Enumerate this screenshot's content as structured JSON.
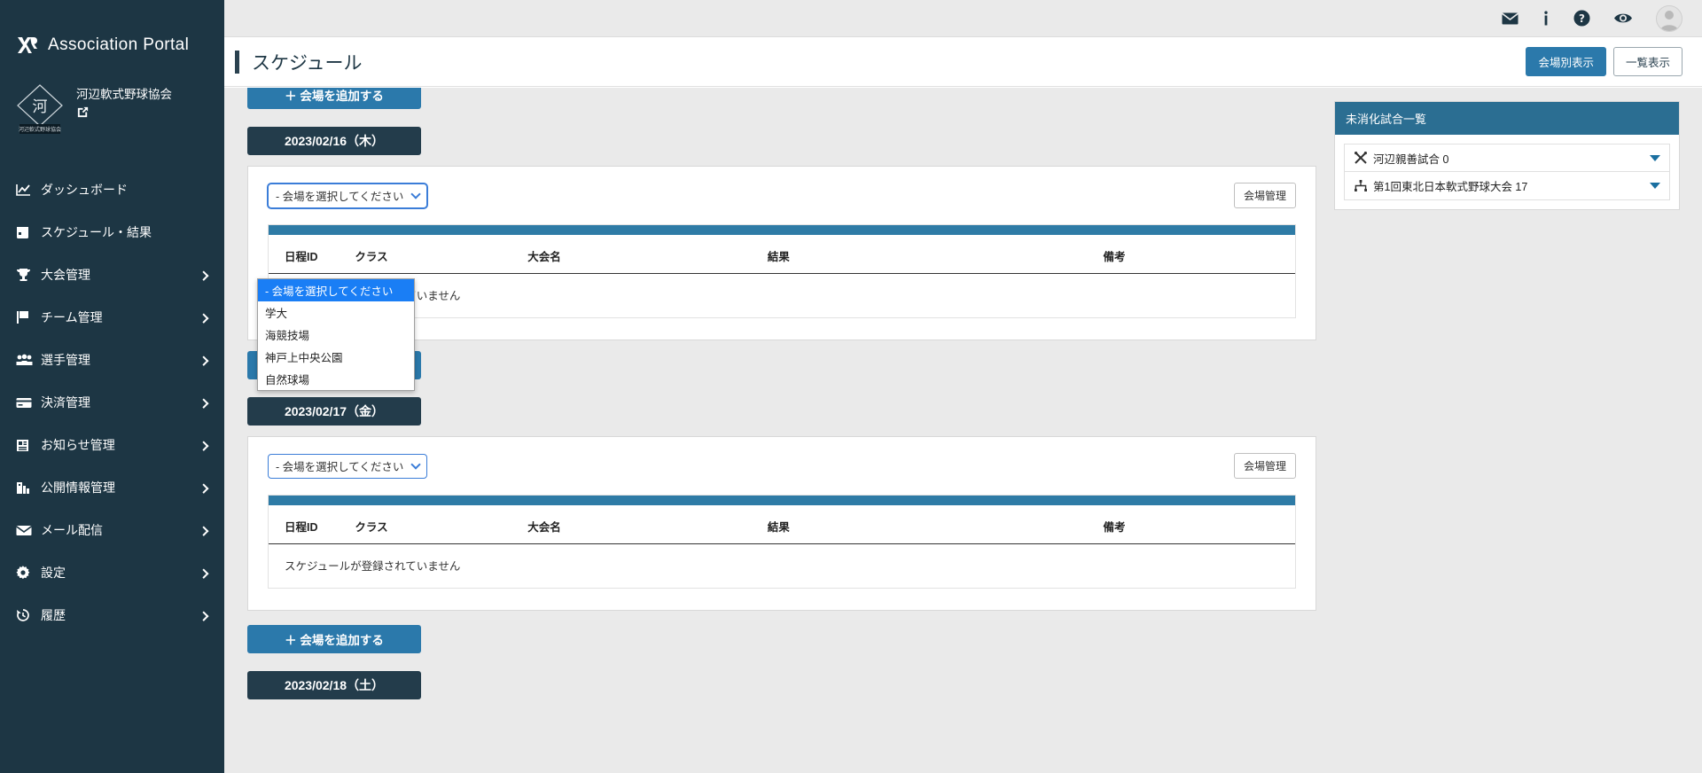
{
  "brand": {
    "name": "Association Portal",
    "logo_icon": "xr-logo-icon"
  },
  "organization": {
    "name": "河辺軟式野球協会",
    "badge_text": "河",
    "badge_caption": "河辺軟式野球協会",
    "external_link_icon": "external-link-icon"
  },
  "sidebar": {
    "items": [
      {
        "label": "ダッシュボード",
        "icon": "chart-line-icon",
        "has_children": false
      },
      {
        "label": "スケジュール・結果",
        "icon": "calendar-icon",
        "has_children": false
      },
      {
        "label": "大会管理",
        "icon": "trophy-icon",
        "has_children": true
      },
      {
        "label": "チーム管理",
        "icon": "flag-icon",
        "has_children": true
      },
      {
        "label": "選手管理",
        "icon": "users-icon",
        "has_children": true
      },
      {
        "label": "決済管理",
        "icon": "credit-card-icon",
        "has_children": true
      },
      {
        "label": "お知らせ管理",
        "icon": "newspaper-icon",
        "has_children": true
      },
      {
        "label": "公開情報管理",
        "icon": "building-icon",
        "has_children": true
      },
      {
        "label": "メール配信",
        "icon": "envelope-icon",
        "has_children": true
      },
      {
        "label": "設定",
        "icon": "gear-icon",
        "has_children": true
      },
      {
        "label": "履歴",
        "icon": "history-icon",
        "has_children": true
      }
    ]
  },
  "topbar": {
    "icons": [
      {
        "name": "mail-icon"
      },
      {
        "name": "info-icon"
      },
      {
        "name": "help-icon"
      },
      {
        "name": "eye-icon"
      }
    ],
    "avatar": "user-avatar"
  },
  "header": {
    "title": "スケジュール",
    "buttons": [
      {
        "label": "会場別表示",
        "active": true
      },
      {
        "label": "一覧表示",
        "active": false
      }
    ]
  },
  "main": {
    "add_venue_label": "＋ 会場を追加する",
    "venue_manage_label": "会場管理",
    "select_placeholder": "- 会場を選択してください",
    "empty_message": "スケジュールが登録されていません",
    "columns": [
      "日程ID",
      "クラス",
      "大会名",
      "結果",
      "備考"
    ],
    "venue_options": [
      "- 会場を選択してください",
      "学大",
      "海競技場",
      "神戸上中央公園",
      "自然球場"
    ],
    "dates": [
      {
        "label": "2023/02/16（木）"
      },
      {
        "label": "2023/02/17（金）"
      },
      {
        "label": "2023/02/18（土）"
      }
    ]
  },
  "side_panel": {
    "title": "未消化試合一覧",
    "rows": [
      {
        "label": "河辺親善試合 0",
        "icon": "crossed-bats-icon"
      },
      {
        "label": "第1回東北日本軟式野球大会 17",
        "icon": "bracket-icon"
      }
    ]
  },
  "colors": {
    "sidebar_bg": "#1d3644",
    "accent_blue": "#2b79ab",
    "table_bar": "#2e7ba6",
    "date_bg": "#233c4b",
    "highlight": "#1a7ef5"
  }
}
